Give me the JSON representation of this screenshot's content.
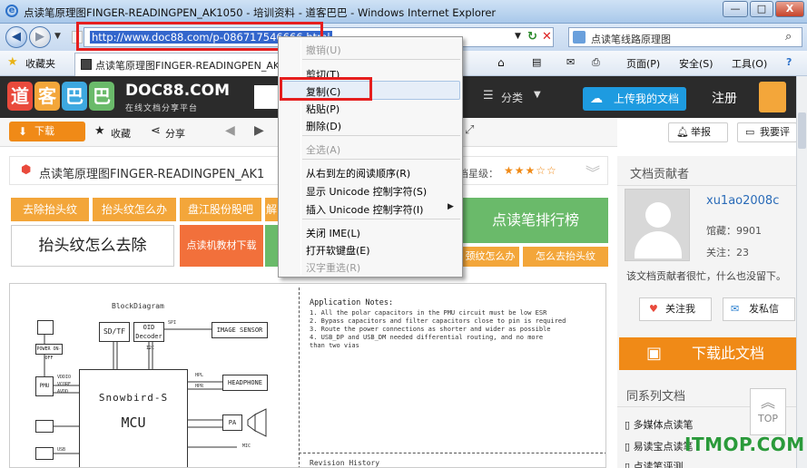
{
  "window": {
    "title": "点读笔原理图FINGER-READINGPEN_AK1050 - 培训资料 - 道客巴巴 - Windows Internet Explorer",
    "buttons": {
      "minimize": "—",
      "maximize": "□",
      "close": "X"
    }
  },
  "address_bar": {
    "url": "http://www.doc88.com/p-086717546666.html",
    "search_text": "点读笔线路原理图"
  },
  "favorites_bar": {
    "favorites_label": "收藏夹",
    "tab_title": "点读笔原理图FINGER-READINGPEN_AK10...",
    "commands": [
      "页面(P)",
      "安全(S)",
      "工具(O)"
    ]
  },
  "site_header": {
    "logo_chars": [
      "道",
      "客",
      "巴",
      "巴"
    ],
    "brand": "DOC88.COM",
    "brand_sub": "在线文档分享平台",
    "category_label": "分类",
    "upload_label": "上传我的文档",
    "register_label": "注册"
  },
  "toolbar": {
    "download": "下载",
    "favorite": "收藏",
    "share": "分享",
    "report": "举报",
    "comment": "我要评"
  },
  "document": {
    "title": "点读笔原理图FINGER-READINGPEN_AK1",
    "rating_label": "档星级：",
    "rating_stars": "★★★☆☆",
    "tags_row1": [
      "去除抬头纹",
      "抬头纹怎么办",
      "盘江股份股吧",
      "解"
    ],
    "big_tag": "抬头纹怎么去除",
    "tag_small": "点读机教材下载",
    "rank_tag": "点读笔排行榜",
    "tags_row2": [
      "颈纹怎么办",
      "怎么去抬头纹"
    ]
  },
  "diagram": {
    "title": "BlockDiagram",
    "blocks": [
      "SD/TF",
      "OID Decoder",
      "IMAGE SENSOR",
      "HEADPHONE",
      "PA",
      "Snowbird-S",
      "MCU"
    ],
    "small_labels": [
      "POWER ON-OFF",
      "PMU",
      "VDDIO",
      "VCORE",
      "AVDD",
      "HPL",
      "HPR",
      "MIC",
      "SPI",
      "I2C",
      "USB"
    ],
    "notes_title": "Application Notes:",
    "notes": [
      "1. All the polar capacitors in the PMU circuit must be low ESR",
      "2. Bypass capacitors and filter capacitors close to pin is required",
      "3. Route the power connections as shorter and wider as possible",
      "4. USB_DP and USB_DM needed differential routing, and no more",
      "   than two vias"
    ],
    "revision_title": "Revision History"
  },
  "sidebar": {
    "contributor_title": "文档贡献者",
    "username": "xu1ao2008c",
    "stats": [
      "馆藏：9901",
      "关注：23"
    ],
    "note": "该文档贡献者很忙，什么也没留下。",
    "follow_btn": "关注我",
    "message_btn": "发私信",
    "download_btn": "下载此文档",
    "series_title": "同系列文档",
    "series_items": [
      "多媒体点读笔",
      "易读宝点读笔",
      "点读笔评测"
    ]
  },
  "context_menu": {
    "items": [
      {
        "label": "撤销(U)",
        "disabled": true
      },
      {
        "label": "剪切(T)",
        "disabled": false
      },
      {
        "label": "复制(C)",
        "disabled": false
      },
      {
        "label": "粘贴(P)",
        "disabled": false
      },
      {
        "label": "删除(D)",
        "disabled": false
      },
      {
        "label": "全选(A)",
        "disabled": true
      },
      {
        "label": "从右到左的阅读顺序(R)",
        "disabled": false
      },
      {
        "label": "显示 Unicode 控制字符(S)",
        "disabled": false
      },
      {
        "label": "插入 Unicode 控制字符(I)",
        "disabled": false
      },
      {
        "label": "关闭 IME(L)",
        "disabled": false
      },
      {
        "label": "打开软键盘(E)",
        "disabled": false
      },
      {
        "label": "汉字重选(R)",
        "disabled": true
      }
    ]
  },
  "watermark": "ITMOP.COM",
  "top_button": "TOP",
  "colors": {
    "highlight_red": "#e51e1e",
    "orange": "#f08a17",
    "tag_orange": "#f3a63a",
    "tag_green": "#6aba6a",
    "upload_blue": "#1e9be0"
  }
}
